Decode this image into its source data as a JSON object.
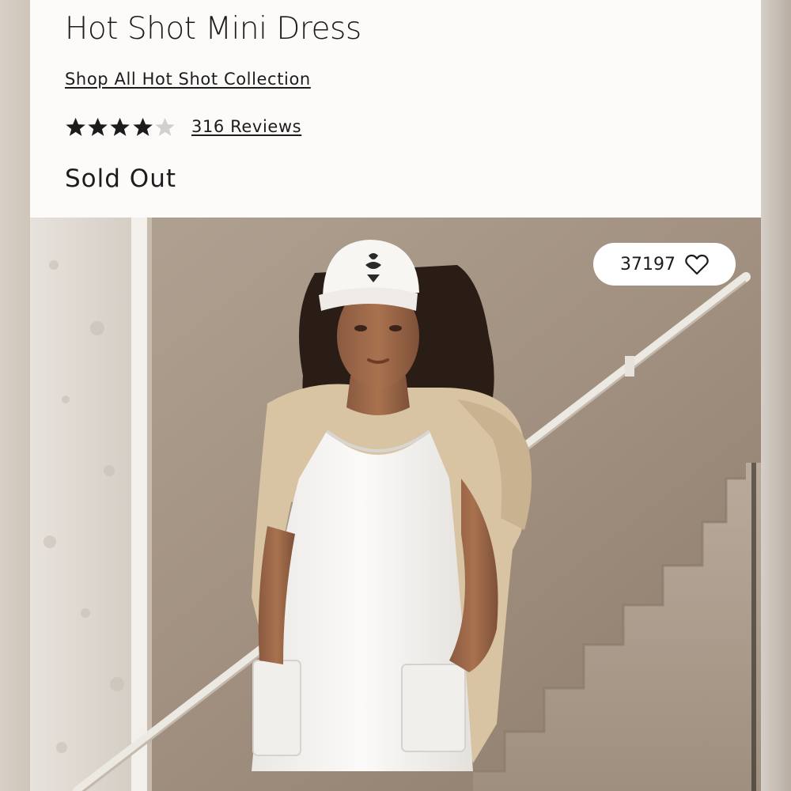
{
  "product": {
    "title": "Hot Shot Mini Dress",
    "collection_link": "Shop All Hot Shot Collection",
    "rating": 4,
    "rating_max": 5,
    "reviews_label": "316 Reviews",
    "availability": "Sold Out"
  },
  "image": {
    "likes_count": "37197",
    "like_icon": "heart-outline-icon"
  },
  "colors": {
    "text": "#1c1c1c",
    "star_filled": "#1c1c1c",
    "star_empty": "#d0d0d0",
    "panel_bg": "#fdfafa"
  }
}
